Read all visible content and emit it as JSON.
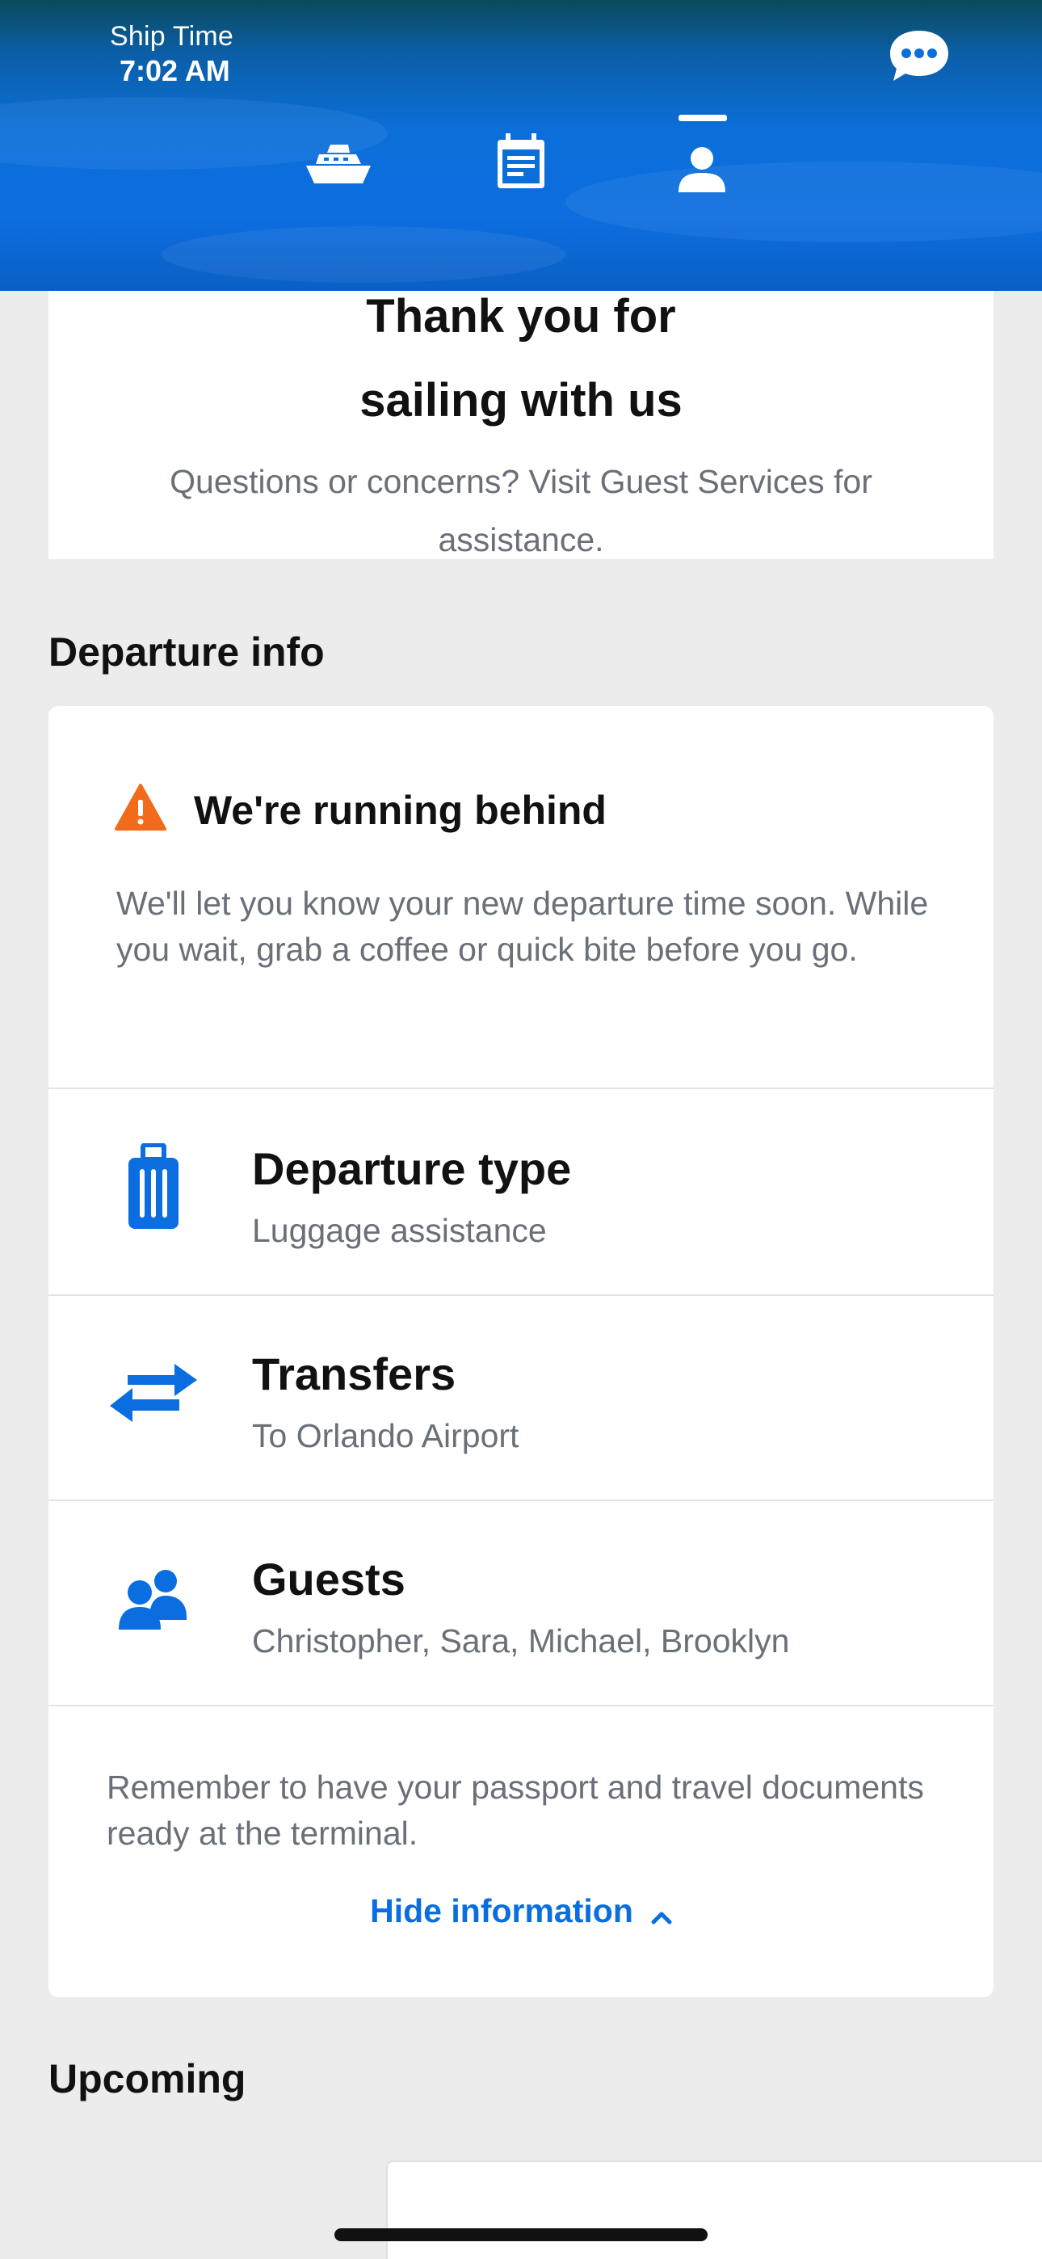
{
  "header": {
    "ship_time_label": "Ship Time",
    "ship_time_value": "7:02 AM",
    "nav": [
      {
        "name": "ship",
        "icon": "ship-icon"
      },
      {
        "name": "calendar",
        "icon": "calendar-icon"
      },
      {
        "name": "profile",
        "icon": "person-icon",
        "active": true
      }
    ],
    "chat_icon": "chat-bubble-icon"
  },
  "farewell": {
    "title_line1": "Thank you for",
    "title_line2": "sailing with us",
    "subtitle": "Questions or concerns? Visit Guest Services for assistance."
  },
  "departure": {
    "section_title": "Departure info",
    "alert_title": "We're running behind",
    "alert_body": "We'll let you know your new departure time soon. While you wait, grab a coffee or quick bite before you go.",
    "rows": [
      {
        "title": "Departure type",
        "value": "Luggage assistance",
        "icon": "luggage-icon"
      },
      {
        "title": "Transfers",
        "value": "To Orlando Airport",
        "icon": "transfer-arrows-icon"
      },
      {
        "title": "Guests",
        "value": "Christopher, Sara, Michael, Brooklyn",
        "icon": "guests-icon"
      }
    ],
    "note": "Remember to have your passport and travel documents ready at the terminal.",
    "hide_label": "Hide information"
  },
  "upcoming": {
    "section_title": "Upcoming"
  },
  "colors": {
    "accent": "#0a6ee0",
    "warning": "#f26b1d",
    "muted_text": "#6a6f78"
  }
}
